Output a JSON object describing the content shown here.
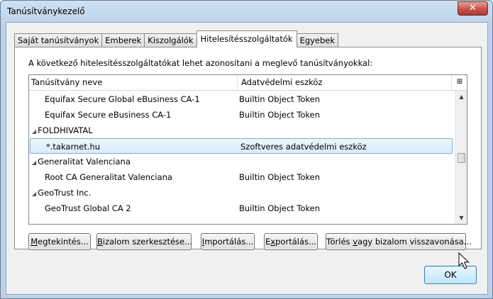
{
  "window": {
    "title": "Tanúsítványkezelő",
    "close_glyph": "✕"
  },
  "tabs": [
    {
      "label": "Saját tanúsítványok",
      "active": false
    },
    {
      "label": "Emberek",
      "active": false
    },
    {
      "label": "Kiszolgálók",
      "active": false
    },
    {
      "label": "Hitelesítésszolgáltatók",
      "active": true
    },
    {
      "label": "Egyebek",
      "active": false
    }
  ],
  "panel": {
    "description": "A következő hitelesítésszolgáltatókat lehet azonosítani a meglevő tanúsítványokkal:"
  },
  "tree": {
    "headers": {
      "name": "Tanúsítvány neve",
      "device": "Adatvédelmi eszköz"
    },
    "rows": [
      {
        "type": "cert",
        "name": "Equifax Secure Global eBusiness CA-1",
        "device": "Builtin Object Token",
        "selected": false
      },
      {
        "type": "cert",
        "name": "Equifax Secure eBusiness CA-1",
        "device": "Builtin Object Token",
        "selected": false
      },
      {
        "type": "group",
        "name": "FOLDHIVATAL",
        "device": "",
        "selected": false
      },
      {
        "type": "cert",
        "name": "*.takarnet.hu",
        "device": "Szoftveres adatvédelmi eszköz",
        "selected": true
      },
      {
        "type": "group",
        "name": "Generalitat Valenciana",
        "device": "",
        "selected": false
      },
      {
        "type": "cert",
        "name": "Root CA Generalitat Valenciana",
        "device": "Builtin Object Token",
        "selected": false
      },
      {
        "type": "group",
        "name": "GeoTrust Inc.",
        "device": "",
        "selected": false
      },
      {
        "type": "cert",
        "name": "GeoTrust Global CA 2",
        "device": "Builtin Object Token",
        "selected": false
      }
    ],
    "expander_glyph": "◢",
    "scroll_up_glyph": "▲",
    "scroll_down_glyph": "▼",
    "column_picker_glyph": "⊞"
  },
  "buttons": {
    "view": {
      "accel": "M",
      "rest": "egtekintés..."
    },
    "edit_trust": {
      "accel": "B",
      "rest": "izalom szerkesztése..."
    },
    "import": {
      "accel": "I",
      "rest": "mportálás..."
    },
    "export": {
      "pre": "E",
      "accel": "x",
      "rest": "portálás..."
    },
    "delete": {
      "pre": "Törlés ",
      "accel": "v",
      "rest": "agy bizalom visszavonása..."
    }
  },
  "ok_label": "OK"
}
